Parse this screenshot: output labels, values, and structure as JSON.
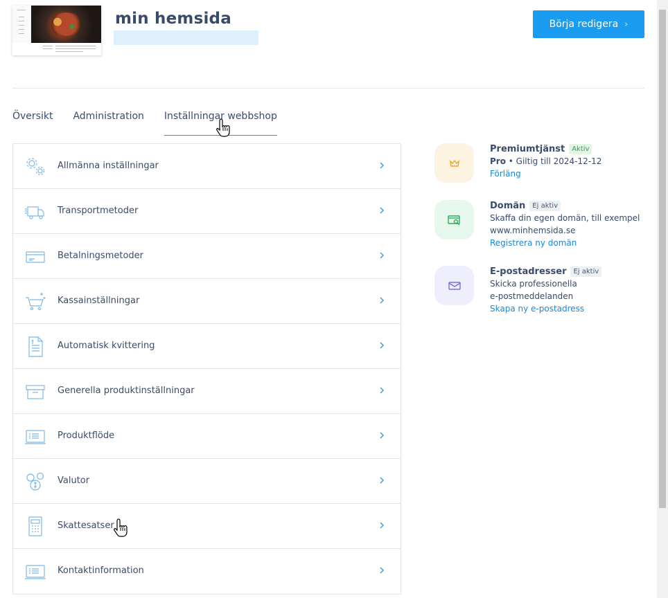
{
  "site": {
    "title": "min hemsida",
    "edit_button": "Börja redigera",
    "edit_chevron": "›"
  },
  "tabs": [
    {
      "label": "Översikt"
    },
    {
      "label": "Administration"
    },
    {
      "label": "Inställningar webbshop"
    }
  ],
  "settings": [
    {
      "label": "Allmänna inställningar",
      "icon": "gears-icon"
    },
    {
      "label": "Transportmetoder",
      "icon": "truck-icon"
    },
    {
      "label": "Betalningsmetoder",
      "icon": "credit-card-icon"
    },
    {
      "label": "Kassainställningar",
      "icon": "cart-icon"
    },
    {
      "label": "Automatisk kvittering",
      "icon": "receipt-icon"
    },
    {
      "label": "Generella produktinställningar",
      "icon": "box-icon"
    },
    {
      "label": "Produktflöde",
      "icon": "feed-icon"
    },
    {
      "label": "Valutor",
      "icon": "currency-icon"
    },
    {
      "label": "Skattesatser",
      "icon": "calculator-icon"
    },
    {
      "label": "Kontaktinformation",
      "icon": "contact-icon"
    }
  ],
  "services": {
    "premium": {
      "title": "Premiumtjänst",
      "status": "Aktiv",
      "plan": "Pro",
      "validity": " • Giltig till 2024-12-12",
      "link": "Förläng",
      "color": "#fdf3e1"
    },
    "domain": {
      "title": "Domän",
      "status": "Ej aktiv",
      "desc1": "Skaffa din egen domän, till exempel",
      "desc2": "www.minhemsida.se",
      "link": "Registrera ny domän",
      "color": "#e6f8ee"
    },
    "email": {
      "title": "E-postadresser",
      "status": "Ej aktiv",
      "desc1": "Skicka professionella",
      "desc2": "e-postmeddelanden",
      "link": "Skapa ny e-postadress",
      "color": "#efeefd"
    }
  },
  "colors": {
    "accent": "#1a9df0",
    "text": "#3a4b6a"
  }
}
